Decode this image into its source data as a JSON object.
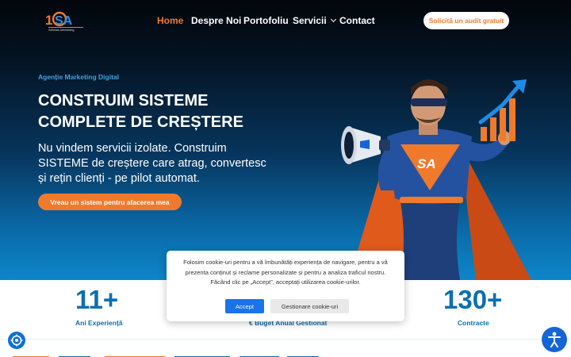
{
  "header": {
    "logo_text": "SA",
    "logo_caption": "Sellmark Advertising",
    "nav": [
      {
        "label": "Home",
        "active": true
      },
      {
        "label": "Despre Noi",
        "active": false
      },
      {
        "label": "Portofoliu",
        "active": false
      },
      {
        "label": "Servicii",
        "active": false,
        "has_dropdown": true
      },
      {
        "label": "Contact",
        "active": false
      }
    ],
    "audit_button": "Solicită un audit gratuit"
  },
  "hero": {
    "eyebrow": "Agenție Marketing Digital",
    "headline_line1": "CONSTRUIM SISTEME",
    "headline_line2": "COMPLETE DE CREȘTERE",
    "subline": "Nu vindem servicii izolate. Construim SISTEME de creștere care atrag, convertesc și rețin clienți - pe pilot automat.",
    "cta": "Vreau un sistem pentru afacerea mea",
    "hero_badge": "SA"
  },
  "stats": [
    {
      "value": "11+",
      "label": "Ani Experiență"
    },
    {
      "value": "",
      "label": "€ Buget Anual Gestionat"
    },
    {
      "value": "130+",
      "label": "Contracte"
    }
  ],
  "cookie": {
    "text": "Folosim cookie-uri pentru a vă îmbunătăți experiența de navigare, pentru a vă prezenta conținut și reclame personalizate și pentru a analiza traficul nostru. Făcând clic pe „Accept”, acceptați utilizarea cookie-urilor.",
    "accept": "Accept",
    "manage": "Gestionare cookie-uri"
  },
  "colors": {
    "accent_orange": "#ef7a2e",
    "brand_blue": "#0b6fb0",
    "cookie_accept_blue": "#1a73e8"
  },
  "icons": {
    "settings_fab": "gear-icon",
    "accessibility_fab": "accessibility-icon"
  }
}
